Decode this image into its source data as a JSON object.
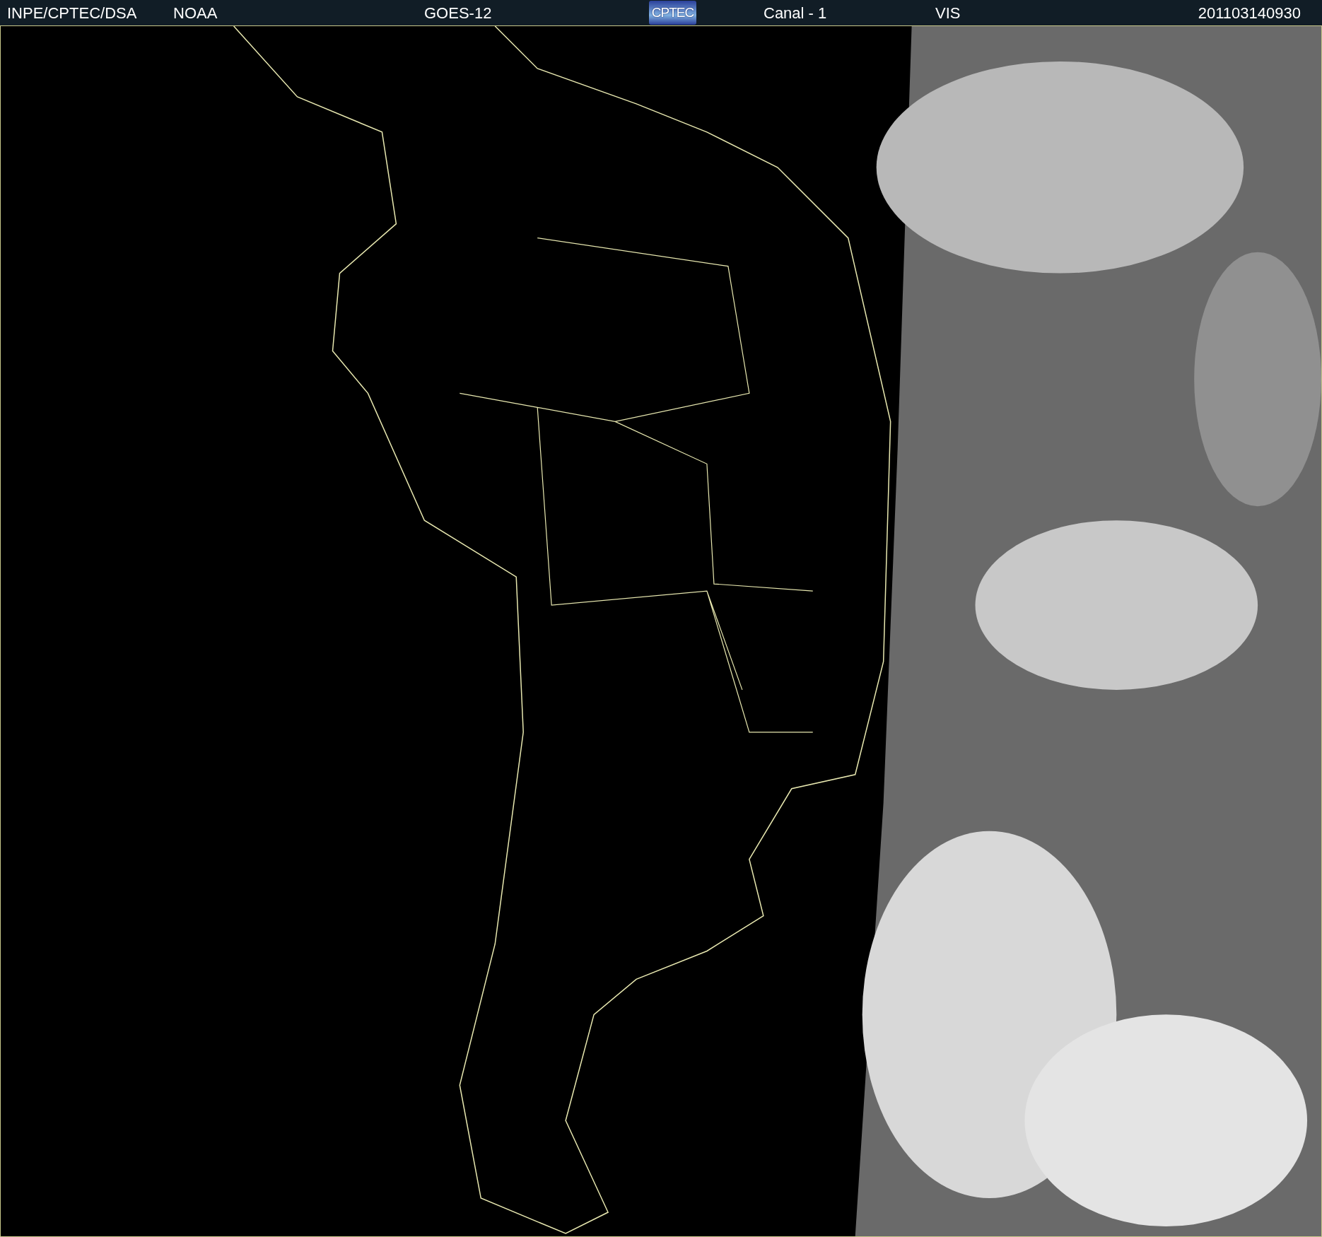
{
  "header": {
    "items": [
      {
        "kind": "text",
        "text": "INPE/CPTEC/DSA"
      },
      {
        "kind": "text",
        "text": "NOAA"
      },
      {
        "kind": "text",
        "text": "GOES-12"
      },
      {
        "kind": "logo",
        "text": "CPTEC"
      },
      {
        "kind": "text",
        "text": "Canal - 1"
      },
      {
        "kind": "text",
        "text": "VIS"
      },
      {
        "kind": "text",
        "text": "201103140930"
      }
    ]
  }
}
